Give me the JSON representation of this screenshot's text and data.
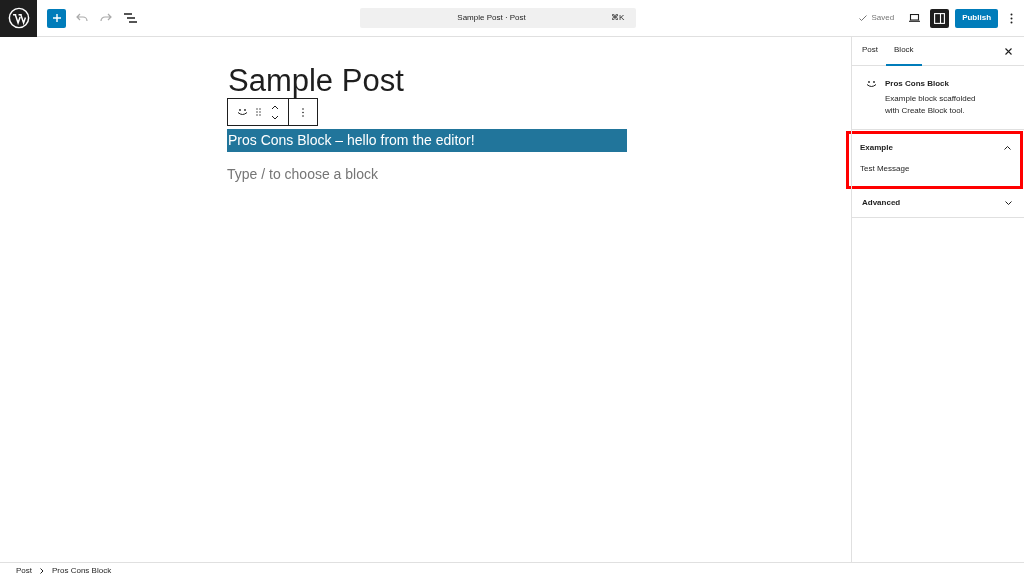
{
  "toolbar": {
    "command_center": "Sample Post · Post",
    "shortcut": "⌘K",
    "save_status": "Saved",
    "publish": "Publish",
    "sidebar_open": true
  },
  "editor": {
    "title": "Sample Post",
    "blocks": [
      {
        "kind": "custom",
        "text": "Pros Cons Block – hello from the editor!",
        "selected": true
      },
      {
        "kind": "placeholder",
        "text": "Type / to choose a block",
        "selected": false
      }
    ]
  },
  "sidebar": {
    "tabs": [
      {
        "label": "Post",
        "selected": false
      },
      {
        "label": "Block",
        "selected": true
      }
    ],
    "block_card": {
      "title": "Pros Cons Block",
      "description": "Example block scaffolded with Create Block tool."
    },
    "panels": [
      {
        "title": "Example",
        "expanded": true,
        "highlighted": true,
        "content": "Test Message"
      },
      {
        "title": "Advanced",
        "expanded": false,
        "highlighted": false
      }
    ]
  },
  "breadcrumb": [
    "Post",
    "Pros Cons Block"
  ]
}
